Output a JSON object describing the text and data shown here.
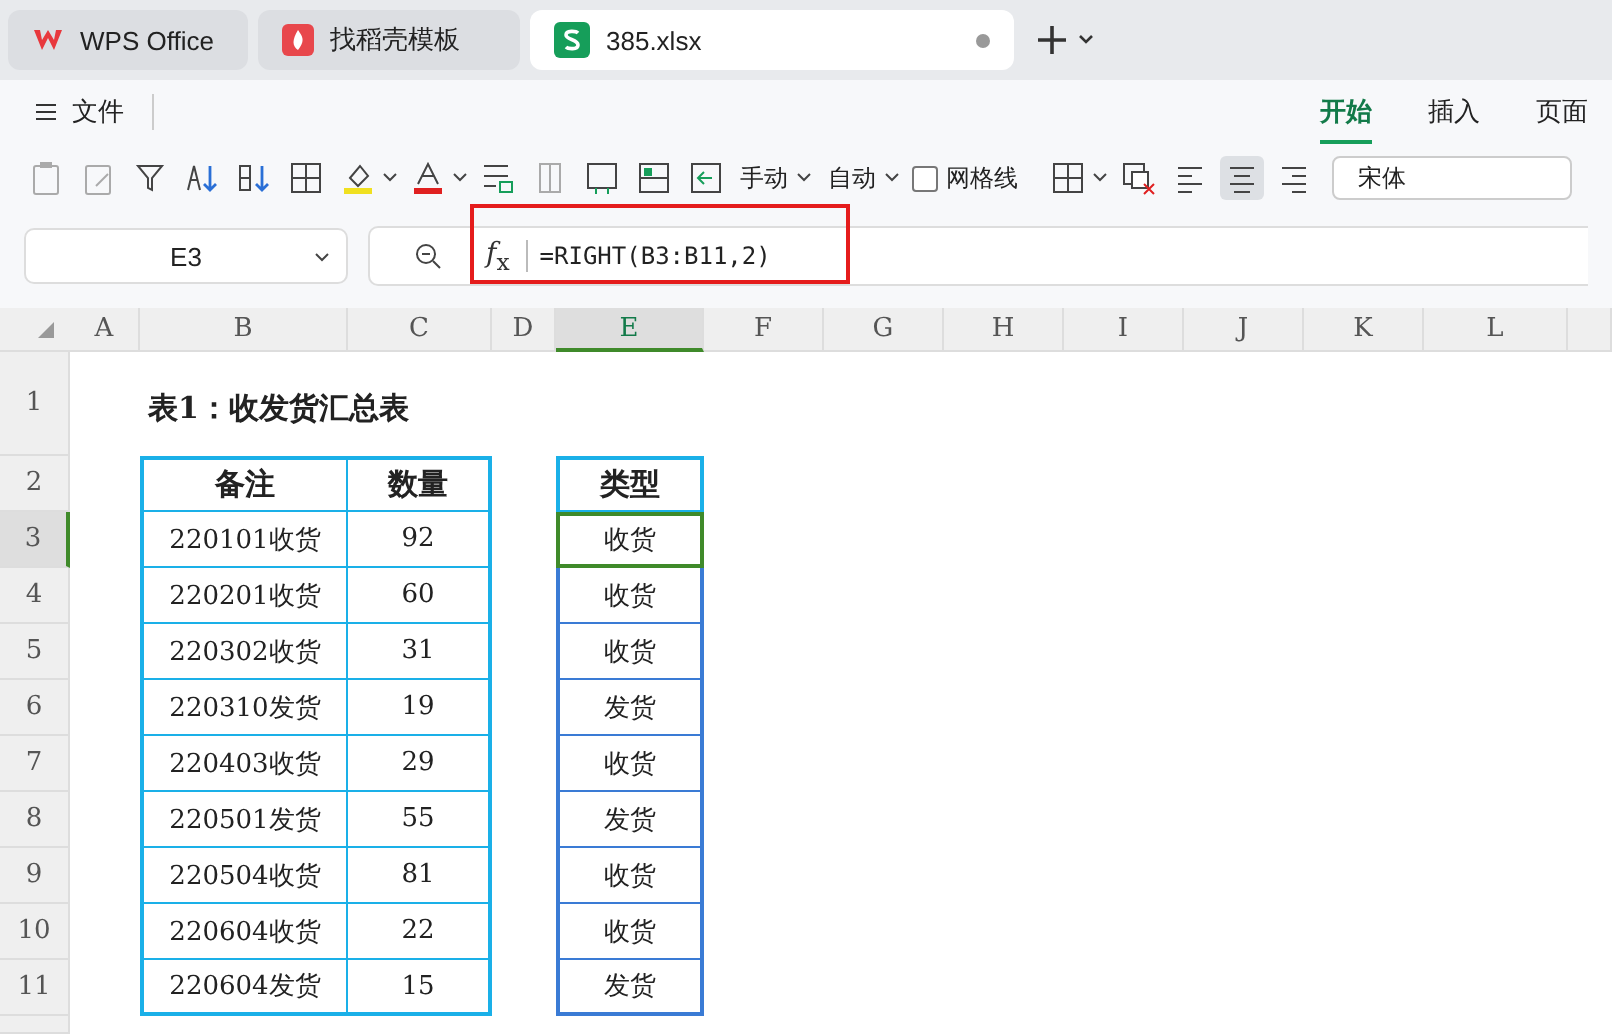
{
  "tabs": [
    {
      "label": "WPS Office",
      "kind": "home",
      "selected": false
    },
    {
      "label": "找稻壳模板",
      "kind": "template",
      "selected": false
    },
    {
      "label": "385.xlsx",
      "kind": "sheet",
      "selected": true
    }
  ],
  "menu": {
    "file": "文件",
    "tabs": [
      {
        "label": "开始",
        "selected": true
      },
      {
        "label": "插入",
        "selected": false
      },
      {
        "label": "页面",
        "selected": false
      }
    ]
  },
  "toolbar": {
    "wrap_mode": "手动",
    "fit_mode": "自动",
    "gridlines": {
      "label": "网格线",
      "checked": false
    },
    "font": "宋体"
  },
  "formula_bar": {
    "cell": "E3",
    "function_label": "*f*$_{x}$",
    "formula": "=RIGHT(B3:B11,2)",
    "highlighted": true
  },
  "sheet": {
    "columns": [
      {
        "label": "A",
        "selected": false
      },
      {
        "label": "B",
        "selected": false
      },
      {
        "label": "C",
        "selected": false
      },
      {
        "label": "D",
        "selected": false
      },
      {
        "label": "E",
        "selected": true
      },
      {
        "label": "F",
        "selected": false
      },
      {
        "label": "G",
        "selected": false
      },
      {
        "label": "H",
        "selected": false
      },
      {
        "label": "I",
        "selected": false
      },
      {
        "label": "J",
        "selected": false
      },
      {
        "label": "K",
        "selected": false
      },
      {
        "label": "L",
        "selected": false
      }
    ],
    "rows": [
      {
        "label": "1",
        "selected": false
      },
      {
        "label": "2",
        "selected": false
      },
      {
        "label": "3",
        "selected": true
      },
      {
        "label": "4",
        "selected": false
      },
      {
        "label": "5",
        "selected": false
      },
      {
        "label": "6",
        "selected": false
      },
      {
        "label": "7",
        "selected": false
      },
      {
        "label": "8",
        "selected": false
      },
      {
        "label": "9",
        "selected": false
      },
      {
        "label": "10",
        "selected": false
      },
      {
        "label": "11",
        "selected": false
      }
    ],
    "title": "表1：收发货汇总表",
    "table1": {
      "columns": [
        "备注",
        "数量"
      ],
      "rows": [
        [
          "220101收货",
          "92"
        ],
        [
          "220201收货",
          "60"
        ],
        [
          "220302收货",
          "31"
        ],
        [
          "220310发货",
          "19"
        ],
        [
          "220403收货",
          "29"
        ],
        [
          "220501发货",
          "55"
        ],
        [
          "220504收货",
          "81"
        ],
        [
          "220604收货",
          "22"
        ],
        [
          "220604发货",
          "15"
        ]
      ]
    },
    "table2": {
      "column": "类型",
      "rows": [
        {
          "value": "收货",
          "selected": true
        },
        {
          "value": "收货",
          "selected": false
        },
        {
          "value": "收货",
          "selected": false
        },
        {
          "value": "发货",
          "selected": false
        },
        {
          "value": "收货",
          "selected": false
        },
        {
          "value": "发货",
          "selected": false
        },
        {
          "value": "收货",
          "selected": false
        },
        {
          "value": "收货",
          "selected": false
        },
        {
          "value": "发货",
          "selected": false
        }
      ]
    }
  }
}
